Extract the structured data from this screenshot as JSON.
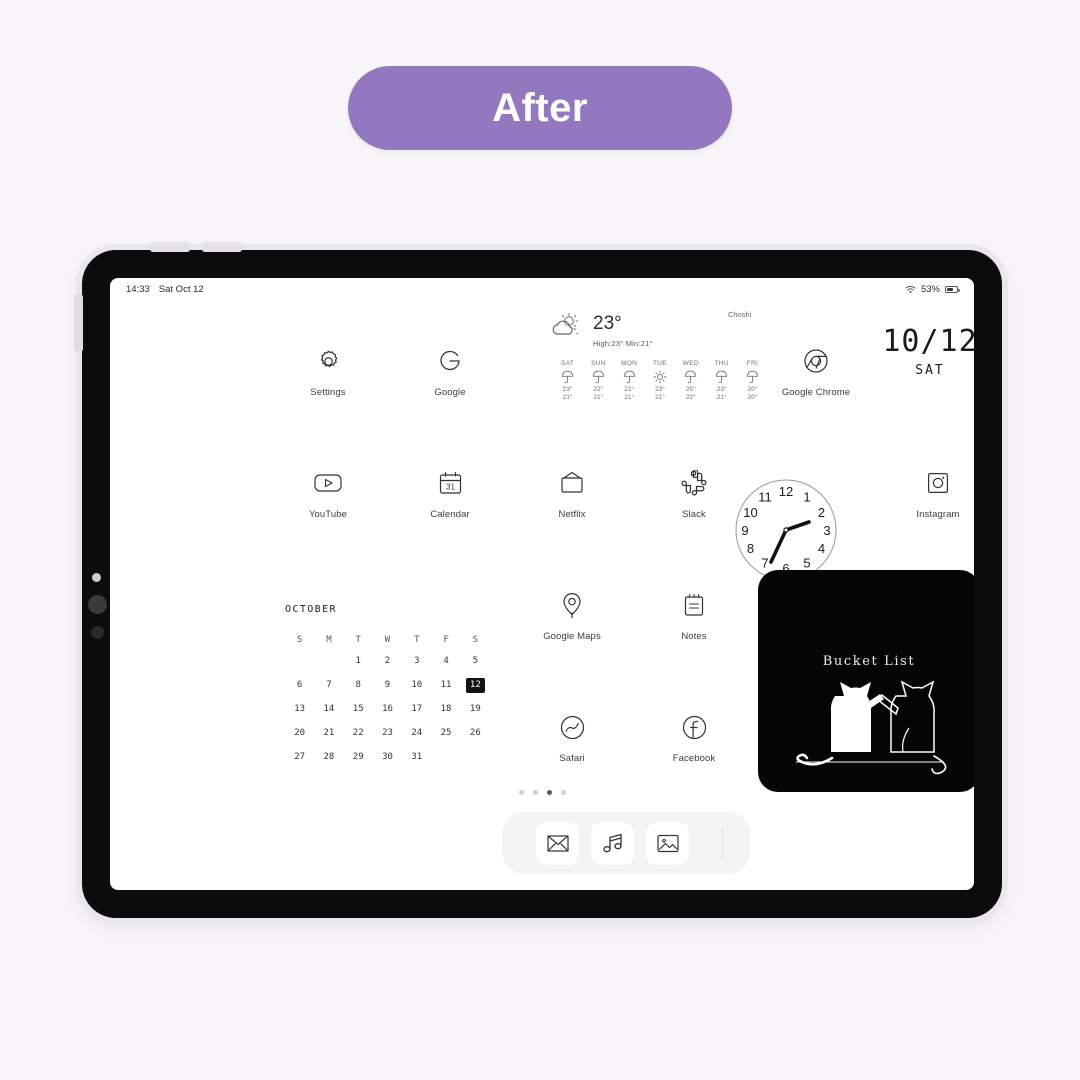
{
  "banner": {
    "label": "After",
    "color": "#9478bf"
  },
  "device": {
    "screen_bg": "#ffffff",
    "bezel": "#0c0c0c"
  },
  "status_bar": {
    "time": "14:33",
    "date": "Sat Oct 12",
    "wifi_icon": "wifi-icon",
    "battery_percent": "53%",
    "battery_icon": "battery-icon"
  },
  "weather": {
    "city": "Choshi",
    "current_temp": "23°",
    "condition_icon": "sun-behind-cloud-icon",
    "high_low": "High:23° Min:21°",
    "forecast": [
      {
        "day": "SAT",
        "icon": "umbrella-icon",
        "high": "23°",
        "low": "21°"
      },
      {
        "day": "SUN",
        "icon": "umbrella-icon",
        "high": "22°",
        "low": "21°"
      },
      {
        "day": "MON",
        "icon": "umbrella-icon",
        "high": "22°",
        "low": "21°"
      },
      {
        "day": "TUE",
        "icon": "sun-icon",
        "high": "23°",
        "low": "21°"
      },
      {
        "day": "WED",
        "icon": "umbrella-icon",
        "high": "25°",
        "low": "22°"
      },
      {
        "day": "THU",
        "icon": "umbrella-icon",
        "high": "23°",
        "low": "21°"
      },
      {
        "day": "FRI",
        "icon": "umbrella-icon",
        "high": "20°",
        "low": "20°"
      }
    ]
  },
  "date_widget": {
    "date": "10/12",
    "weekday": "SAT"
  },
  "clock_widget": {
    "hours": [
      "12",
      "1",
      "2",
      "3",
      "4",
      "5",
      "6",
      "7",
      "8",
      "9",
      "10",
      "11"
    ],
    "time_shown": "2:33"
  },
  "apps": {
    "row1": [
      {
        "name": "Settings",
        "icon": "gear-icon"
      },
      {
        "name": "Google",
        "icon": "google-g-icon"
      },
      {
        "name": "Google Chrome",
        "icon": "chrome-icon"
      }
    ],
    "row2": [
      {
        "name": "YouTube",
        "icon": "youtube-icon"
      },
      {
        "name": "Calendar",
        "icon": "calendar-icon"
      },
      {
        "name": "Netflix",
        "icon": "tv-icon"
      },
      {
        "name": "Slack",
        "icon": "slack-icon"
      },
      {
        "name": "Instagram",
        "icon": "instagram-icon"
      }
    ],
    "row3": [
      {
        "name": "Google Maps",
        "icon": "map-pin-icon"
      },
      {
        "name": "Notes",
        "icon": "notepad-icon"
      }
    ],
    "row4": [
      {
        "name": "Safari",
        "icon": "compass-icon"
      },
      {
        "name": "Facebook",
        "icon": "facebook-icon"
      }
    ]
  },
  "calendar_widget": {
    "month": "OCTOBER",
    "weekdays": [
      "S",
      "M",
      "T",
      "W",
      "T",
      "F",
      "S"
    ],
    "lead_blanks": 2,
    "days": [
      1,
      2,
      3,
      4,
      5,
      6,
      7,
      8,
      9,
      10,
      11,
      12,
      13,
      14,
      15,
      16,
      17,
      18,
      19,
      20,
      21,
      22,
      23,
      24,
      25,
      26,
      27,
      28,
      29,
      30,
      31
    ],
    "today": 12
  },
  "bucket_widget": {
    "title": "Bucket List",
    "art": "two-cats-icon",
    "bg": "#050505"
  },
  "page_dots": {
    "count": 4,
    "active_index": 2
  },
  "dock": [
    {
      "name": "Mail",
      "icon": "envelope-icon"
    },
    {
      "name": "Music",
      "icon": "music-note-icon"
    },
    {
      "name": "Photos",
      "icon": "photo-icon"
    }
  ]
}
